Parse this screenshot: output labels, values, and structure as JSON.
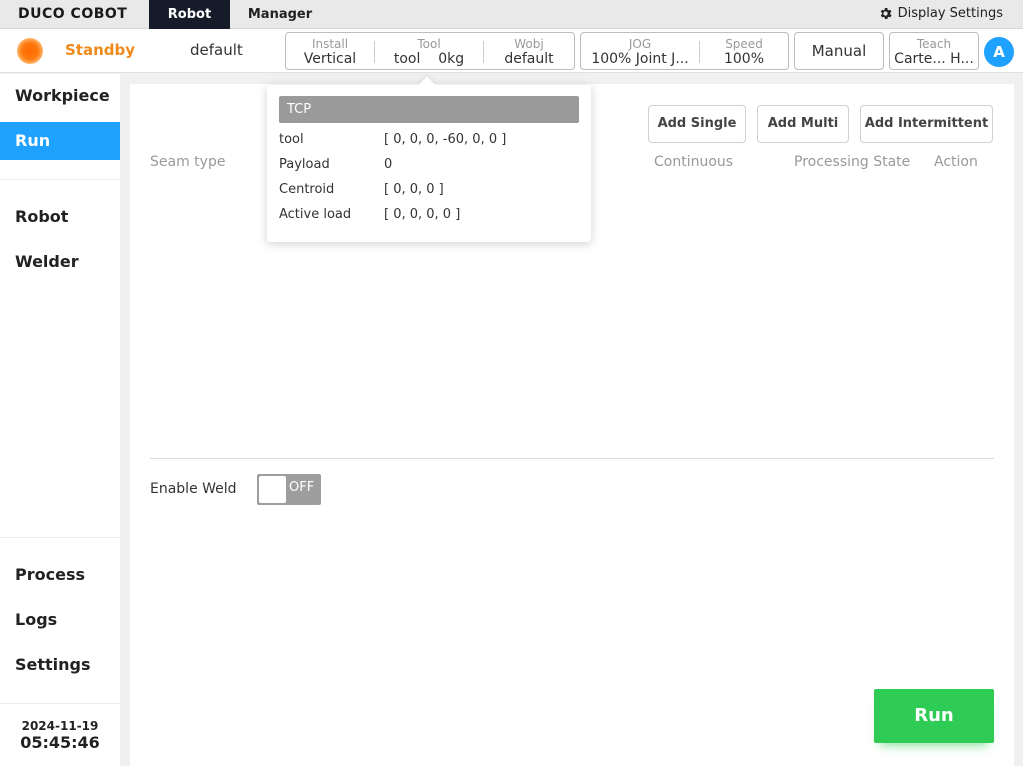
{
  "nav": {
    "logo": "DUCO COBOT",
    "tabs": [
      "Robot",
      "Manager"
    ],
    "display_settings": "Display Settings"
  },
  "status": {
    "state": "Standby",
    "profile": "default",
    "install": {
      "label": "Install",
      "value": "Vertical"
    },
    "tool": {
      "label": "Tool",
      "value": "tool",
      "load": "0kg"
    },
    "wobj": {
      "label": "Wobj",
      "value": "default"
    },
    "jog": {
      "label": "JOG",
      "value": "100% Joint J..."
    },
    "speed": {
      "label": "Speed",
      "value": "100%"
    },
    "mode": "Manual",
    "teach": {
      "label": "Teach",
      "value": "Carte... H..."
    },
    "user_initial": "A",
    "colors": {
      "standby": "#ee8a1a",
      "accent": "#1ea1ff",
      "run": "#2ecc54"
    }
  },
  "sidebar": {
    "items": [
      {
        "label": "Workpiece"
      },
      {
        "label": "Run"
      },
      {
        "label": "Robot"
      },
      {
        "label": "Welder"
      },
      {
        "label": "Process"
      },
      {
        "label": "Logs"
      },
      {
        "label": "Settings"
      }
    ],
    "active": "Run",
    "date": "2024-11-19",
    "time": "05:45:46"
  },
  "main": {
    "add_single": "Add Single",
    "add_multi": "Add Multi",
    "add_intermittent": "Add Intermittent",
    "columns": {
      "seam_type": "Seam type",
      "continuous": "Continuous",
      "processing_state": "Processing State",
      "action": "Action"
    },
    "enable_weld_label": "Enable Weld",
    "weld_toggle_state": "OFF",
    "run_button": "Run"
  },
  "tcp_popover": {
    "title": "TCP",
    "rows": [
      {
        "key": "tool",
        "value": "[ 0, 0, 0, -60, 0, 0 ]"
      },
      {
        "key": "Payload",
        "value": "0"
      },
      {
        "key": "Centroid",
        "value": "[ 0, 0, 0 ]"
      },
      {
        "key": "Active load",
        "value": "[ 0, 0, 0, 0 ]"
      }
    ]
  }
}
